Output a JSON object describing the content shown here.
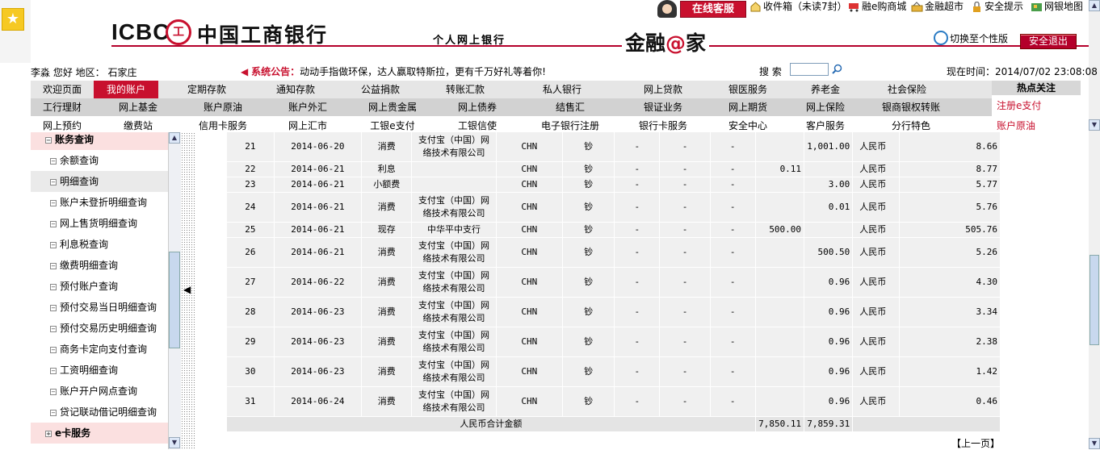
{
  "header": {
    "star": "★",
    "logo_text": "ICBC",
    "logo_symbol": "工",
    "bank_name": "中国工商银行",
    "subtitle": "个人网上银行",
    "brand_pre": "金融",
    "brand_at": "@",
    "brand_post": "家",
    "online_service": "在线客服",
    "links": [
      "收件箱（未读7封）",
      "融e购商城",
      "金融超市",
      "安全提示",
      "网银地图"
    ],
    "switch_version": "切换至个性版",
    "logout": "安全退出"
  },
  "info": {
    "user": "李淼 您好 地区： 石家庄",
    "notice_label": "系统公告：",
    "notice_text": "动动手指做环保，达人赢取特斯拉，更有千万好礼等着你!",
    "search_label": "搜 索",
    "search_value": "",
    "time": "现在时间：2014/07/02 23:08:08"
  },
  "nav": {
    "row1": [
      "欢迎页面",
      "我的账户",
      "定期存款",
      "通知存款",
      "公益捐款",
      "转账汇款",
      "私人银行",
      "网上贷款",
      "银医服务",
      "养老金",
      "社会保险"
    ],
    "row2": [
      "工行理财",
      "网上基金",
      "账户原油",
      "账户外汇",
      "网上贵金属",
      "网上债券",
      "结售汇",
      "银证业务",
      "网上期货",
      "网上保险",
      "银商银权转账"
    ],
    "row3": [
      "网上预约",
      "缴费站",
      "信用卡服务",
      "网上汇市",
      "工银e支付",
      "工银信使",
      "电子银行注册",
      "银行卡服务",
      "安全中心",
      "客户服务",
      "分行特色"
    ]
  },
  "hot": {
    "title": "热点关注",
    "links": [
      "注册e支付",
      "账户原油"
    ]
  },
  "sidebar": {
    "section": "账务查询",
    "items": [
      "余额查询",
      "明细查询",
      "账户未登折明细查询",
      "网上售货明细查询",
      "利息税查询",
      "缴费明细查询",
      "预付账户查询",
      "预付交易当日明细查询",
      "预付交易历史明细查询",
      "商务卡定向支付查询",
      "工资明细查询",
      "账户开户网点查询",
      "贷记联动借记明细查询"
    ],
    "footer_section": "e卡服务",
    "collapse": "◀"
  },
  "table": {
    "rows": [
      {
        "no": "21",
        "date": "2014-06-20",
        "type": "消费",
        "party": "支付宝（中国）网络技术有限公司",
        "cc": "CHN",
        "cash": "钞",
        "d1": "-",
        "d2": "-",
        "d3": "-",
        "income": "",
        "expense": "1,001.00",
        "currency": "人民币",
        "balance": "8.66"
      },
      {
        "no": "22",
        "date": "2014-06-21",
        "type": "利息",
        "party": "",
        "cc": "CHN",
        "cash": "钞",
        "d1": "-",
        "d2": "-",
        "d3": "-",
        "income": "0.11",
        "expense": "",
        "currency": "人民币",
        "balance": "8.77"
      },
      {
        "no": "23",
        "date": "2014-06-21",
        "type": "小额费",
        "party": "",
        "cc": "CHN",
        "cash": "钞",
        "d1": "-",
        "d2": "-",
        "d3": "-",
        "income": "",
        "expense": "3.00",
        "currency": "人民币",
        "balance": "5.77"
      },
      {
        "no": "24",
        "date": "2014-06-21",
        "type": "消费",
        "party": "支付宝（中国）网络技术有限公司",
        "cc": "CHN",
        "cash": "钞",
        "d1": "-",
        "d2": "-",
        "d3": "-",
        "income": "",
        "expense": "0.01",
        "currency": "人民币",
        "balance": "5.76"
      },
      {
        "no": "25",
        "date": "2014-06-21",
        "type": "现存",
        "party": "中华平中支行",
        "cc": "CHN",
        "cash": "钞",
        "d1": "-",
        "d2": "-",
        "d3": "-",
        "income": "500.00",
        "expense": "",
        "currency": "人民币",
        "balance": "505.76"
      },
      {
        "no": "26",
        "date": "2014-06-21",
        "type": "消费",
        "party": "支付宝（中国）网络技术有限公司",
        "cc": "CHN",
        "cash": "钞",
        "d1": "-",
        "d2": "-",
        "d3": "-",
        "income": "",
        "expense": "500.50",
        "currency": "人民币",
        "balance": "5.26"
      },
      {
        "no": "27",
        "date": "2014-06-22",
        "type": "消费",
        "party": "支付宝（中国）网络技术有限公司",
        "cc": "CHN",
        "cash": "钞",
        "d1": "-",
        "d2": "-",
        "d3": "-",
        "income": "",
        "expense": "0.96",
        "currency": "人民币",
        "balance": "4.30"
      },
      {
        "no": "28",
        "date": "2014-06-23",
        "type": "消费",
        "party": "支付宝（中国）网络技术有限公司",
        "cc": "CHN",
        "cash": "钞",
        "d1": "-",
        "d2": "-",
        "d3": "-",
        "income": "",
        "expense": "0.96",
        "currency": "人民币",
        "balance": "3.34"
      },
      {
        "no": "29",
        "date": "2014-06-23",
        "type": "消费",
        "party": "支付宝（中国）网络技术有限公司",
        "cc": "CHN",
        "cash": "钞",
        "d1": "-",
        "d2": "-",
        "d3": "-",
        "income": "",
        "expense": "0.96",
        "currency": "人民币",
        "balance": "2.38"
      },
      {
        "no": "30",
        "date": "2014-06-23",
        "type": "消费",
        "party": "支付宝（中国）网络技术有限公司",
        "cc": "CHN",
        "cash": "钞",
        "d1": "-",
        "d2": "-",
        "d3": "-",
        "income": "",
        "expense": "0.96",
        "currency": "人民币",
        "balance": "1.42"
      },
      {
        "no": "31",
        "date": "2014-06-24",
        "type": "消费",
        "party": "支付宝（中国）网络技术有限公司",
        "cc": "CHN",
        "cash": "钞",
        "d1": "-",
        "d2": "-",
        "d3": "-",
        "income": "",
        "expense": "0.96",
        "currency": "人民币",
        "balance": "0.46"
      }
    ],
    "total_label": "人民币合计金额",
    "total_income": "7,850.11",
    "total_expense": "7,859.31"
  },
  "pagination": {
    "prev": "【上一页】"
  },
  "colors": {
    "brand_red": "#c8102e",
    "nav_active": "#c8102e"
  }
}
